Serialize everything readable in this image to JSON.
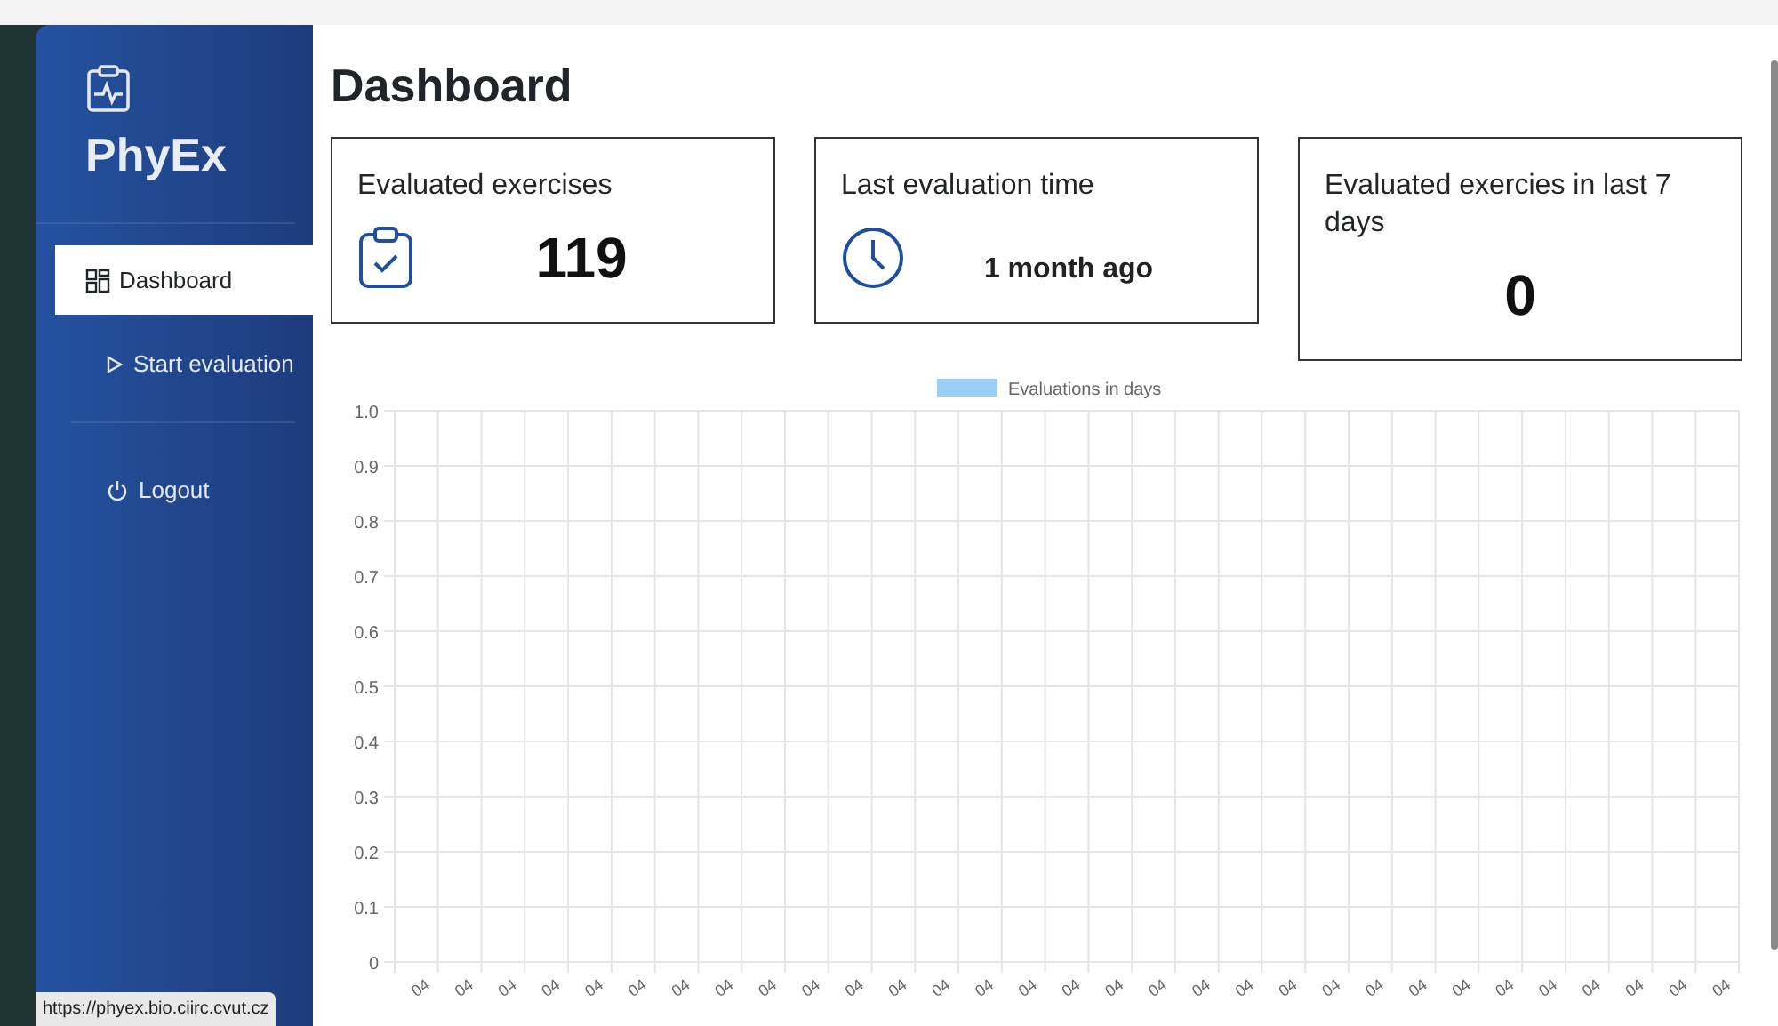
{
  "sidebar": {
    "brand": "PhyEx",
    "items": [
      {
        "label": "Dashboard",
        "selected": true
      },
      {
        "label": "Start evaluation",
        "selected": false
      },
      {
        "label": "Logout",
        "selected": false
      }
    ]
  },
  "page_title": "Dashboard",
  "cards": [
    {
      "title": "Evaluated exercises",
      "value": "119",
      "kind": "big"
    },
    {
      "title": "Last evaluation time",
      "value": "1 month ago",
      "kind": "small"
    },
    {
      "title": "Evaluated exercies in last 7 days",
      "value": "0",
      "kind": "big"
    }
  ],
  "chart": {
    "chart_data": {
      "type": "bar",
      "grid": true,
      "categories": [
        "04",
        "04",
        "04",
        "04",
        "04",
        "04",
        "04",
        "04",
        "04",
        "04",
        "04",
        "04",
        "04",
        "04",
        "04",
        "04",
        "04",
        "04",
        "04",
        "04",
        "04",
        "04",
        "04",
        "04",
        "04",
        "04",
        "04",
        "04",
        "04",
        "04",
        "04"
      ],
      "series": [
        {
          "name": "Evaluations in days",
          "color": "#9ad0f5",
          "values": [
            0,
            0,
            0,
            0,
            0,
            0,
            0,
            0,
            0,
            0,
            0,
            0,
            0,
            0,
            0,
            0,
            0,
            0,
            0,
            0,
            0,
            0,
            0,
            0,
            0,
            0,
            0,
            0,
            0,
            0,
            0
          ]
        }
      ],
      "ylim": [
        0,
        1
      ],
      "yticks": [
        {
          "value": 0,
          "label": "0"
        },
        {
          "value": 0.1,
          "label": "0.1"
        },
        {
          "value": 0.2,
          "label": "0.2"
        },
        {
          "value": 0.3,
          "label": "0.3"
        },
        {
          "value": 0.4,
          "label": "0.4"
        },
        {
          "value": 0.5,
          "label": "0.5"
        },
        {
          "value": 0.6,
          "label": "0.6"
        },
        {
          "value": 0.7,
          "label": "0.7"
        },
        {
          "value": 0.8,
          "label": "0.8"
        },
        {
          "value": 0.9,
          "label": "0.9"
        },
        {
          "value": 1,
          "label": "1.0"
        }
      ]
    }
  },
  "status_url": "https://phyex.bio.ciirc.cvut.cz"
}
